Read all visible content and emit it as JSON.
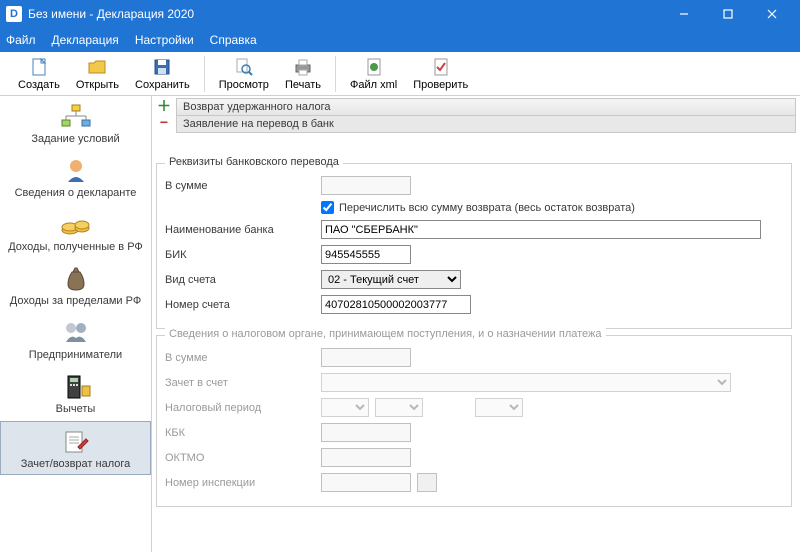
{
  "window": {
    "title": "Без имени - Декларация 2020"
  },
  "menu": {
    "file": "Файл",
    "declaration": "Декларация",
    "settings": "Настройки",
    "help": "Справка"
  },
  "toolbar": {
    "create": "Создать",
    "open": "Открыть",
    "save": "Сохранить",
    "preview": "Просмотр",
    "print": "Печать",
    "xml": "Файл xml",
    "check": "Проверить"
  },
  "sidebar": {
    "conditions": "Задание условий",
    "declarant": "Сведения о декларанте",
    "income_rf": "Доходы, полученные в РФ",
    "income_foreign": "Доходы за пределами РФ",
    "entrepreneur": "Предприниматели",
    "deductions": "Вычеты",
    "refund": "Зачет/возврат налога"
  },
  "tree": {
    "row1": "Возврат удержанного налога",
    "row2": "Заявление на перевод в банк"
  },
  "bank": {
    "legend": "Реквизиты банковского перевода",
    "sum_label": "В сумме",
    "sum_value": "",
    "full_refund_label": "Перечислить всю сумму возврата (весь остаток возврата)",
    "name_label": "Наименование банка",
    "name_value": "ПАО \"СБЕРБАНК\"",
    "bik_label": "БИК",
    "bik_value": "945545555",
    "account_type_label": "Вид счета",
    "account_type_value": "02 - Текущий счет",
    "account_no_label": "Номер счета",
    "account_no_value": "40702810500002003777"
  },
  "tax": {
    "legend": "Сведения о налоговом органе, принимающем поступления, и о назначении платежа",
    "sum_label": "В сумме",
    "offset_label": "Зачет в счет",
    "period_label": "Налоговый период",
    "kbk_label": "КБК",
    "oktmo_label": "ОКТМО",
    "inspection_label": "Номер инспекции"
  }
}
